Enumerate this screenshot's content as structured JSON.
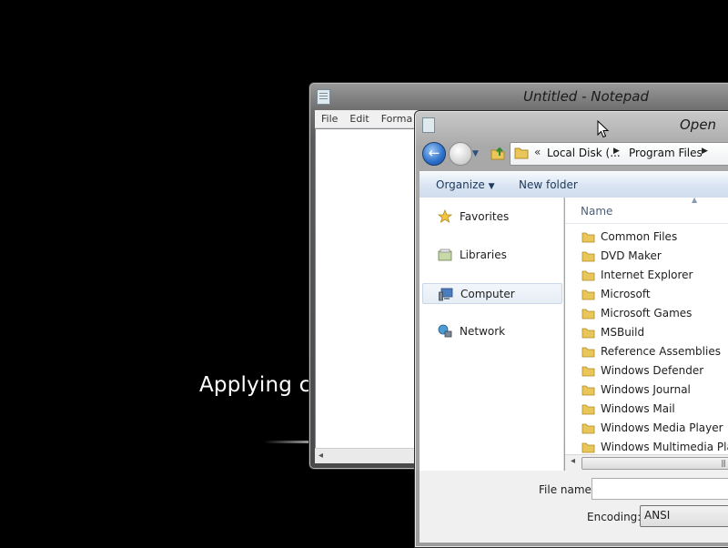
{
  "background": {
    "status_text": "Applying co"
  },
  "notepad": {
    "title": "Untitled - Notepad",
    "menu": [
      "File",
      "Edit",
      "Forma"
    ]
  },
  "open_dialog": {
    "title": "Open",
    "breadcrumb": {
      "overflow": "«",
      "segments": [
        "Local Disk (...",
        "Program Files"
      ]
    },
    "toolbar": {
      "organize_label": "Organize",
      "new_folder_label": "New folder"
    },
    "nav": {
      "favorites": "Favorites",
      "libraries": "Libraries",
      "computer": "Computer",
      "network": "Network"
    },
    "column_header": "Name",
    "files": [
      "Common Files",
      "DVD Maker",
      "Internet Explorer",
      "Microsoft",
      "Microsoft Games",
      "MSBuild",
      "Reference Assemblies",
      "Windows Defender",
      "Windows Journal",
      "Windows Mail",
      "Windows Media Player",
      "Windows Multimedia Platf"
    ],
    "file_name_label": "File name:",
    "file_name_value": "",
    "encoding_label": "Encoding:",
    "encoding_value": "ANSI"
  },
  "colors": {
    "desktop": "#000000",
    "folder": "#e8c65a",
    "accent": "#2a6fc9"
  }
}
